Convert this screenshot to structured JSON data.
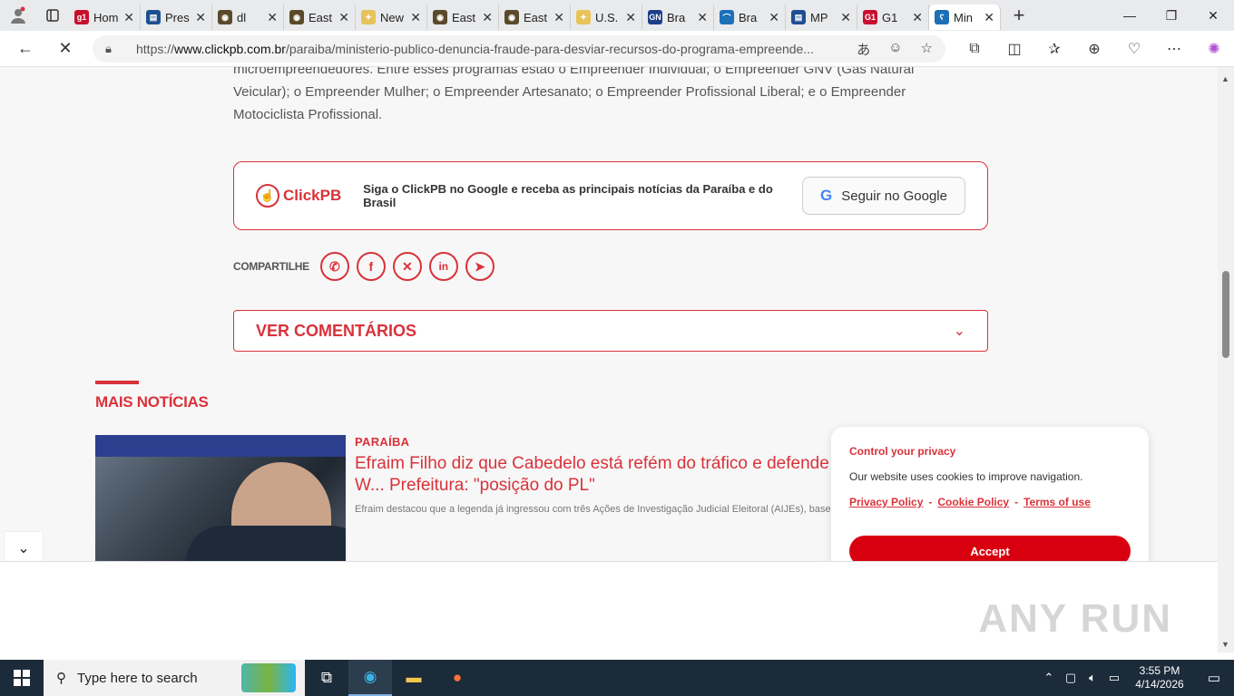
{
  "browser": {
    "tabs": [
      {
        "label": "Hom",
        "fav_color": "#c8102e",
        "fav_text": "g1"
      },
      {
        "label": "Pres",
        "fav_color": "#1d4f91",
        "fav_text": "▤"
      },
      {
        "label": "dl",
        "fav_color": "#5a4a2a",
        "fav_text": "◉"
      },
      {
        "label": "East",
        "fav_color": "#5a4a2a",
        "fav_text": "◉"
      },
      {
        "label": "New",
        "fav_color": "#e8c25a",
        "fav_text": "✦"
      },
      {
        "label": "East",
        "fav_color": "#5a4a2a",
        "fav_text": "◉"
      },
      {
        "label": "East",
        "fav_color": "#5a4a2a",
        "fav_text": "◉"
      },
      {
        "label": "U.S.",
        "fav_color": "#e8c25a",
        "fav_text": "✦"
      },
      {
        "label": "Bra",
        "fav_color": "#1d3f8a",
        "fav_text": "GN"
      },
      {
        "label": "Bra",
        "fav_color": "#1d6fb8",
        "fav_text": "⌒"
      },
      {
        "label": "MP",
        "fav_color": "#1d4f91",
        "fav_text": "▤"
      },
      {
        "label": "G1",
        "fav_color": "#c8102e",
        "fav_text": "G1"
      },
      {
        "label": "Min",
        "fav_color": "#1d6fb8",
        "fav_text": "ʕ"
      }
    ],
    "url_prefix": "https://",
    "url_domain": "www.clickpb.com.br",
    "url_path": "/paraiba/ministerio-publico-denuncia-fraude-para-desviar-recursos-do-programa-empreende..."
  },
  "article": {
    "paragraph": "microempreendedores. Entre esses programas estão o Empreender Individual; o Empreender GNV (Gás Natural Veicular); o Empreender Mulher; o Empreender Artesanato; o Empreender Profissional Liberal; e o Empreender Motociclista Profissional.",
    "follow_logo": "ClickPB",
    "follow_text": "Siga o ClickPB no Google e receba as principais notícias da Paraíba e do Brasil",
    "follow_button": "Seguir no Google",
    "share_label": "COMPARTILHE",
    "comments_label": "VER COMENTÁRIOS"
  },
  "more_news": {
    "title": "MAIS NOTÍCIAS",
    "items": [
      {
        "category": "PARAÍBA",
        "title": "Efraim Filho diz que Cabedelo está refém do tráfico e defende W... Prefeitura: \"posição do PL\"",
        "description": "Efraim destacou que a legenda já ingressou com três Ações de Investigação Judicial Eleitoral (AIJEs), baseadas"
      }
    ]
  },
  "cookie": {
    "title": "Control your privacy",
    "text": "Our website uses cookies to improve navigation.",
    "links": [
      "Privacy Policy",
      "Cookie Policy",
      "Terms of use"
    ],
    "accept": "Accept"
  },
  "watermark": "ANY RUN",
  "taskbar": {
    "search_placeholder": "Type here to search",
    "time": "3:55 PM",
    "date": "4/14/2026"
  },
  "colors": {
    "brand_red": "#d9323a",
    "accept_red": "#d8000f"
  }
}
